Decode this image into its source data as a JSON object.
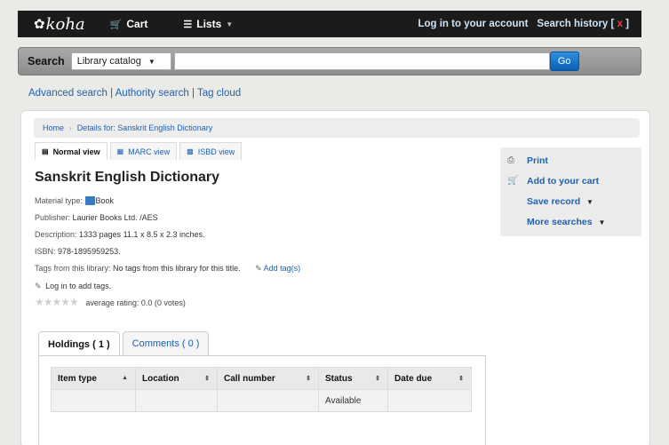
{
  "navbar": {
    "logo_text": "koha",
    "cart_label": "Cart",
    "lists_label": "Lists",
    "login_label": "Log in to your account",
    "search_history_label": "Search history",
    "search_history_clear": "x"
  },
  "search": {
    "label": "Search",
    "scope_selected": "Library catalog",
    "query": "",
    "go_label": "Go"
  },
  "more_search_links": {
    "advanced": "Advanced search",
    "authority": "Authority search",
    "tag_cloud": "Tag cloud"
  },
  "breadcrumb": {
    "home": "Home",
    "current": "Details for: Sanskrit English Dictionary"
  },
  "view_tabs": {
    "normal": "Normal view",
    "marc": "MARC view",
    "isbd": "ISBD view"
  },
  "record": {
    "title": "Sanskrit English Dictionary",
    "material_type_label": "Material type:",
    "material_type_value": "Book",
    "publisher_label": "Publisher:",
    "publisher_value": "Laurier Books Ltd. /AES",
    "description_label": "Description:",
    "description_value": "1333 pages 11.1 x 8.5 x 2.3 inches.",
    "isbn_label": "ISBN:",
    "isbn_value": "978-1895959253.",
    "tags_label": "Tags from this library:",
    "tags_value": "No tags from this library for this title.",
    "add_tag_label": "Add tag(s)",
    "login_to_tag": "Log in to add tags.",
    "rating_text": "average rating: 0.0 (0 votes)",
    "rating_value": 0
  },
  "actions": {
    "print": "Print",
    "add_to_cart": "Add to your cart",
    "save_record": "Save record",
    "more_searches": "More searches"
  },
  "holdings_tabs": {
    "holdings": "Holdings ( 1 )",
    "comments": "Comments ( 0 )"
  },
  "holdings_table": {
    "headers": [
      "Item type",
      "Location",
      "Call number",
      "Status",
      "Date due"
    ],
    "rows": [
      [
        "",
        "",
        "",
        "Available",
        ""
      ]
    ]
  },
  "colors": {
    "link": "#1f60b0",
    "navbar_bg": "#1b1b1b",
    "go_button": "#1a73c9"
  }
}
